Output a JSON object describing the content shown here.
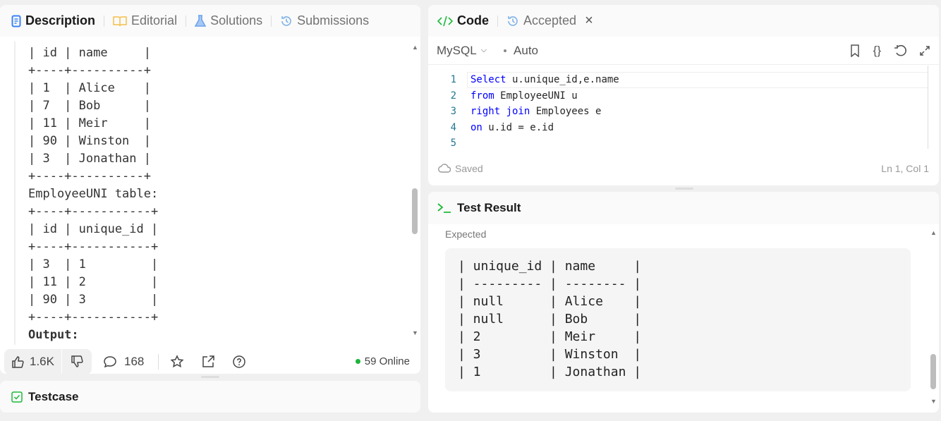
{
  "left_tabs": [
    {
      "label": "Description"
    },
    {
      "label": "Editorial"
    },
    {
      "label": "Solutions"
    },
    {
      "label": "Submissions"
    }
  ],
  "description_lines": [
    "| id | name     |",
    "+----+----------+",
    "| 1  | Alice    |",
    "| 7  | Bob      |",
    "| 11 | Meir     |",
    "| 90 | Winston  |",
    "| 3  | Jonathan |",
    "+----+----------+",
    "EmployeeUNI table:",
    "+----+-----------+",
    "| id | unique_id |",
    "+----+-----------+",
    "| 3  | 1         |",
    "| 11 | 2         |",
    "| 90 | 3         |",
    "+----+-----------+",
    "Output:"
  ],
  "bottom": {
    "likes": "1.6K",
    "comments": "168",
    "online": "59 Online"
  },
  "testcase": {
    "label": "Testcase"
  },
  "code_tabs": {
    "code": "Code",
    "accepted": "Accepted"
  },
  "editor": {
    "language": "MySQL",
    "mode": "Auto",
    "status": "Saved",
    "cursor": "Ln 1, Col 1",
    "lines": [
      {
        "n": "1",
        "kw": "Select",
        "rest": " u.unique_id,e.name"
      },
      {
        "n": "2",
        "kw": "from",
        "rest": " EmployeeUNI u"
      },
      {
        "n": "3",
        "kw": "right join",
        "rest": " Employees e"
      },
      {
        "n": "4",
        "kw": "on",
        "rest": " u.id = e.id"
      },
      {
        "n": "5",
        "kw": "",
        "rest": ""
      }
    ]
  },
  "test_result": {
    "title": "Test Result",
    "expected_label": "Expected",
    "lines": [
      "| unique_id | name     |",
      "| --------- | -------- |",
      "| null      | Alice    |",
      "| null      | Bob      |",
      "| 2         | Meir     |",
      "| 3         | Winston  |",
      "| 1         | Jonathan |"
    ]
  },
  "colors": {
    "accent_green": "#1cba3a",
    "online": "#1fb33a",
    "keyword": "#0000ff"
  }
}
